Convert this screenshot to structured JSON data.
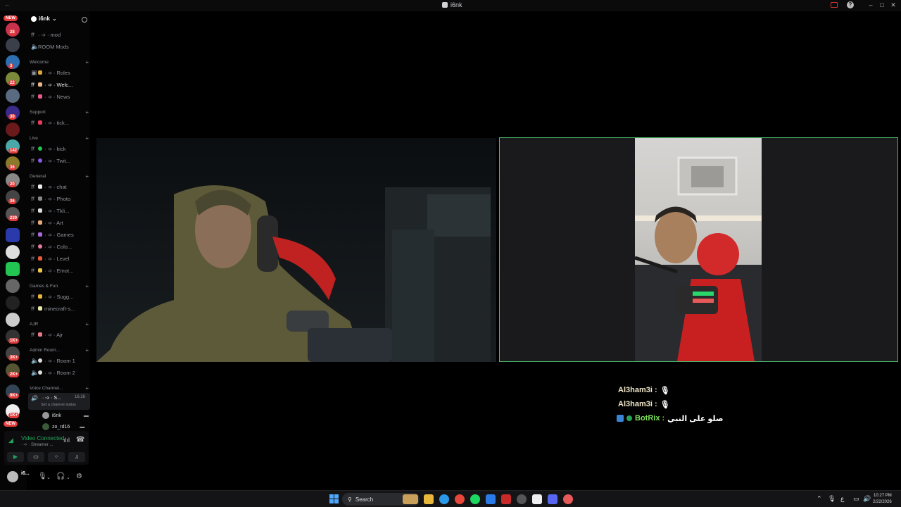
{
  "window": {
    "title": "i6nk"
  },
  "rail": {
    "badges": [
      "28",
      "3",
      "22",
      "30",
      "142",
      "36",
      "20",
      "36",
      "230",
      "1K+",
      "3K+",
      "2K+",
      "9K+",
      "1K+"
    ],
    "new_label": "NEW"
  },
  "server": {
    "name": "i6nk"
  },
  "channels": {
    "mod": "· ➩ · mod",
    "room_mods": "ROOM Mods",
    "cat_welcome": "Welcome",
    "roles": "· ➩ · Roles",
    "welcome": "· ➩ · Welc...",
    "news": "· ➩ · News",
    "cat_support": "Support",
    "ticket": "· ➩ · tick...",
    "cat_live": "Live",
    "kick": "· ➩ · kick",
    "twitch": "· ➩ · Twit...",
    "cat_general": "General",
    "chat": "· ➩ · chat",
    "photo": "· ➩ · Photo",
    "tiktok": "· ➩ · Tkli...",
    "art": "· ➩ · Art",
    "games": "· ➩ · Games",
    "colors": "· ➩ · Colo...",
    "level": "· ➩ · Level",
    "emotes": "· ➩ · Emot...",
    "cat_games_fun": "Games & Fun",
    "suggestions": "· ➩ · Sugg...",
    "minecraft": "minecraft-s...",
    "cat_ajr": "AJR",
    "ajr": "· ➩ · Ajr",
    "cat_admin": "Admin Room...",
    "room1": "· ➩ · Room 1",
    "room2": "· ➩ · Room 2",
    "cat_voice": "Voice Channel...",
    "voice_active": "· ➩ · S...",
    "voice_time": "16:26",
    "voice_status": "Set a channel status",
    "member1": "i6nk",
    "member2": "zo_rd16"
  },
  "voice_panel": {
    "title": "Video Connected",
    "subtitle": "· ➩ · Streamer ..."
  },
  "user": {
    "name": "i6...",
    "status": ""
  },
  "chat": [
    {
      "user": "Al3ham3i :",
      "msg": "🎙"
    },
    {
      "user": "Al3ham3i :",
      "msg": "🎙"
    },
    {
      "user": "BotRix :",
      "msg": "صلو على النبي"
    }
  ],
  "taskbar": {
    "search": "Search",
    "time": "10:27 PM",
    "date": "2/22/2026"
  },
  "colors": {
    "accent_green": "#49b86b",
    "badge_red": "#e23b3b",
    "voice_green": "#23a559"
  }
}
